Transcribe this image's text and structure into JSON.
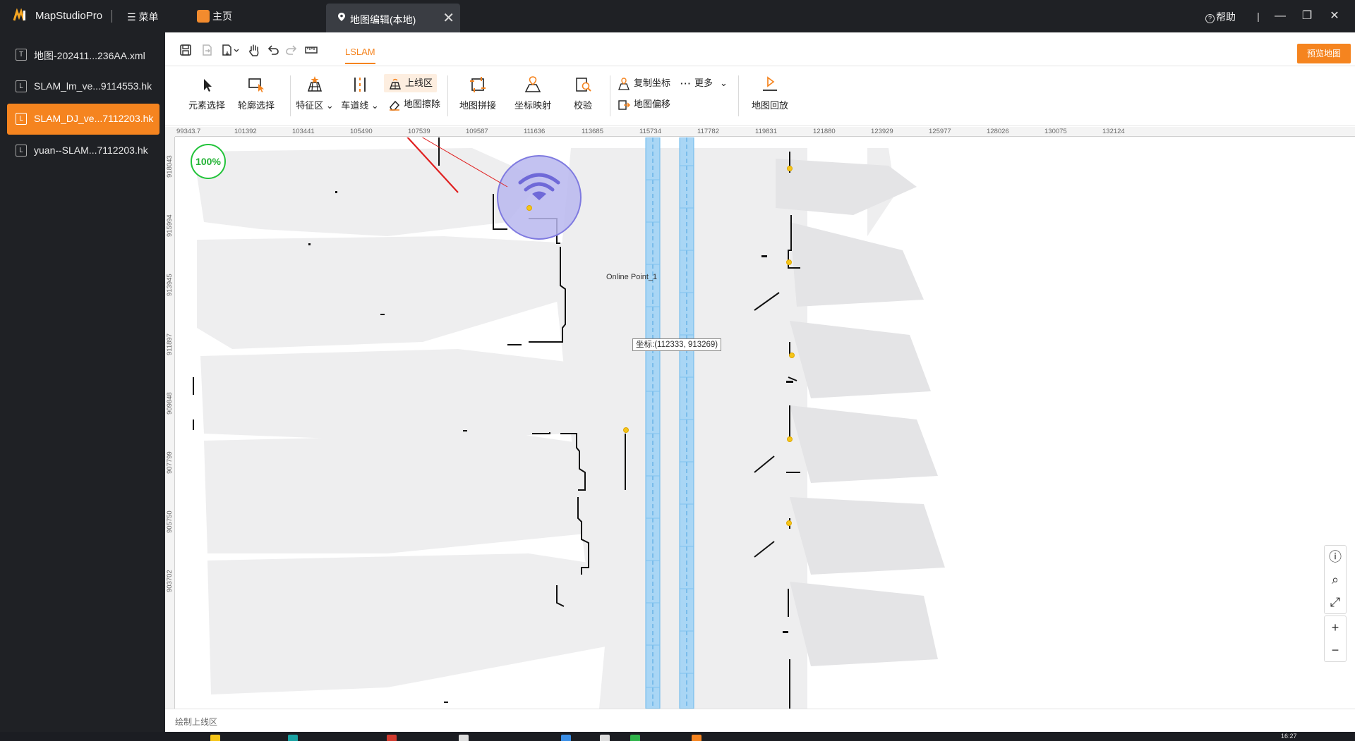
{
  "titlebar": {
    "app_name": "MapStudioPro",
    "menu_label": "☰ 菜单",
    "home_label": "主页",
    "active_tab_label": "地图编辑(本地)",
    "help_label": "帮助"
  },
  "sidebar": {
    "files": [
      {
        "type": "T",
        "name": "地图-202411...236AA.xml",
        "active": false
      },
      {
        "type": "L",
        "name": "SLAM_lm_ve...9114553.hk",
        "active": false
      },
      {
        "type": "L",
        "name": "SLAM_DJ_ve...7112203.hk",
        "active": true
      },
      {
        "type": "L",
        "name": "yuan--SLAM...7112203.hk",
        "active": false
      }
    ]
  },
  "toolbar": {
    "tab_label": "LSLAM",
    "preview_label": "预览地图"
  },
  "ribbon": {
    "element_select": "元素选择",
    "contour_select": "轮廓选择",
    "feature_area": "特征区",
    "lane_line": "车道线",
    "online_area": "上线区",
    "map_erase": "地图擦除",
    "map_stitch": "地图拼接",
    "coord_map": "坐标映射",
    "verify": "校验",
    "copy_coord": "复制坐标",
    "more": "更多",
    "map_offset": "地图偏移",
    "map_replay": "地图回放"
  },
  "canvas": {
    "zoom": "100%",
    "ruler_h": [
      "99343.7",
      "101392",
      "103441",
      "105490",
      "107539",
      "109587",
      "111636",
      "113685",
      "115734",
      "117782",
      "119831",
      "121880",
      "123929",
      "125977",
      "128026",
      "130075",
      "132124"
    ],
    "ruler_v": [
      "918043",
      "915994",
      "913945",
      "911897",
      "909848",
      "907799",
      "905750",
      "903702"
    ],
    "coordinate_tooltip": "坐标:(112333, 913269)",
    "online_point_label": "Online Point_1"
  },
  "status": {
    "text": "绘制上线区"
  },
  "taskbar": {
    "clock": "16:27"
  },
  "colors": {
    "accent": "#f5841f",
    "zoom_badge": "#22c33a",
    "online_point_fill": "#b9b7ef",
    "online_point_stroke": "#7f7ae0",
    "lane_blue": "#a9d6f5"
  }
}
